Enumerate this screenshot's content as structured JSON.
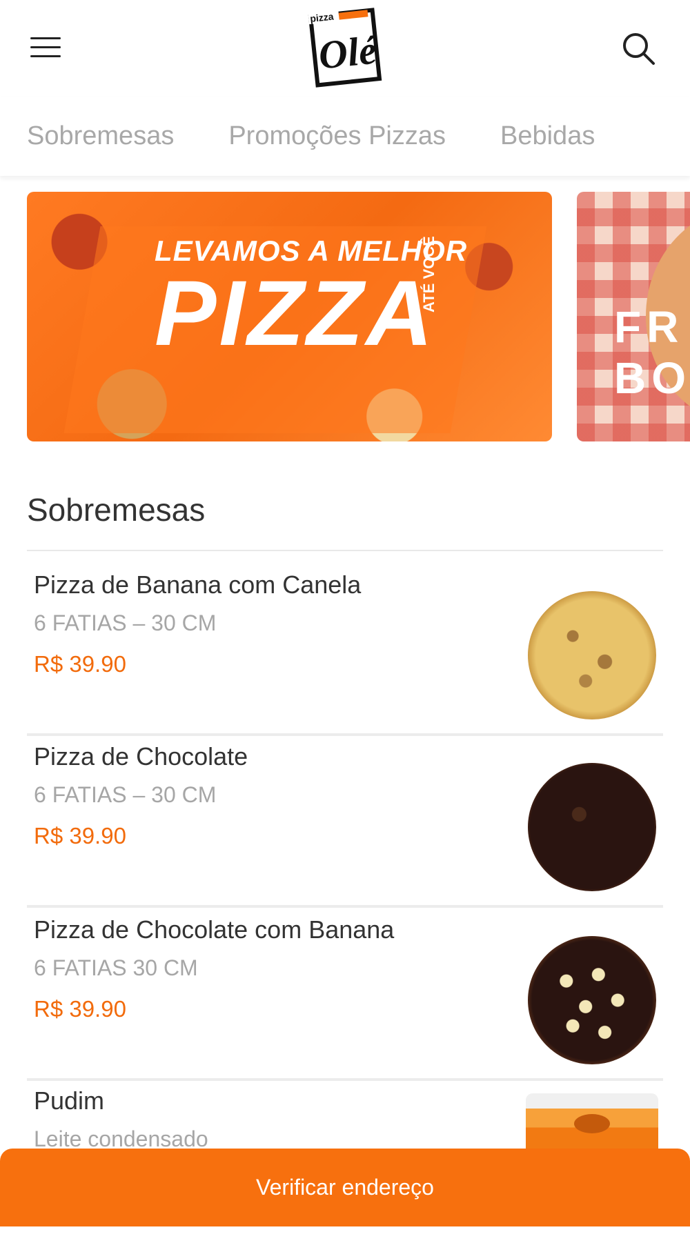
{
  "header": {
    "logo_small_text": "pizza",
    "logo_text": "Olé",
    "menu_icon": "hamburger-menu-icon",
    "search_icon": "search-icon"
  },
  "tabs": [
    {
      "label": "Sobremesas"
    },
    {
      "label": "Promoções Pizzas"
    },
    {
      "label": "Bebidas"
    }
  ],
  "banners": [
    {
      "line1": "LEVAMOS A MELHOR",
      "line2": "PIZZA",
      "line3": "ATÉ VOCÊ"
    },
    {
      "text_line1": "FR",
      "text_line2": "BO"
    }
  ],
  "section": {
    "title": "Sobremesas",
    "items": [
      {
        "name": "Pizza de Banana com Canela",
        "description": "6 FATIAS – 30 CM",
        "price": "R$ 39.90"
      },
      {
        "name": "Pizza de Chocolate",
        "description": "6 FATIAS – 30 CM",
        "price": "R$ 39.90"
      },
      {
        "name": "Pizza de Chocolate com Banana",
        "description": "6 FATIAS 30 CM",
        "price": "R$ 39.90"
      },
      {
        "name": "Pudim",
        "description": "Leite condensado"
      }
    ]
  },
  "cta": {
    "label": "Verificar endereço"
  },
  "colors": {
    "accent": "#f7700e",
    "price": "#f26b0c",
    "tab_text": "#a8a8a8"
  }
}
